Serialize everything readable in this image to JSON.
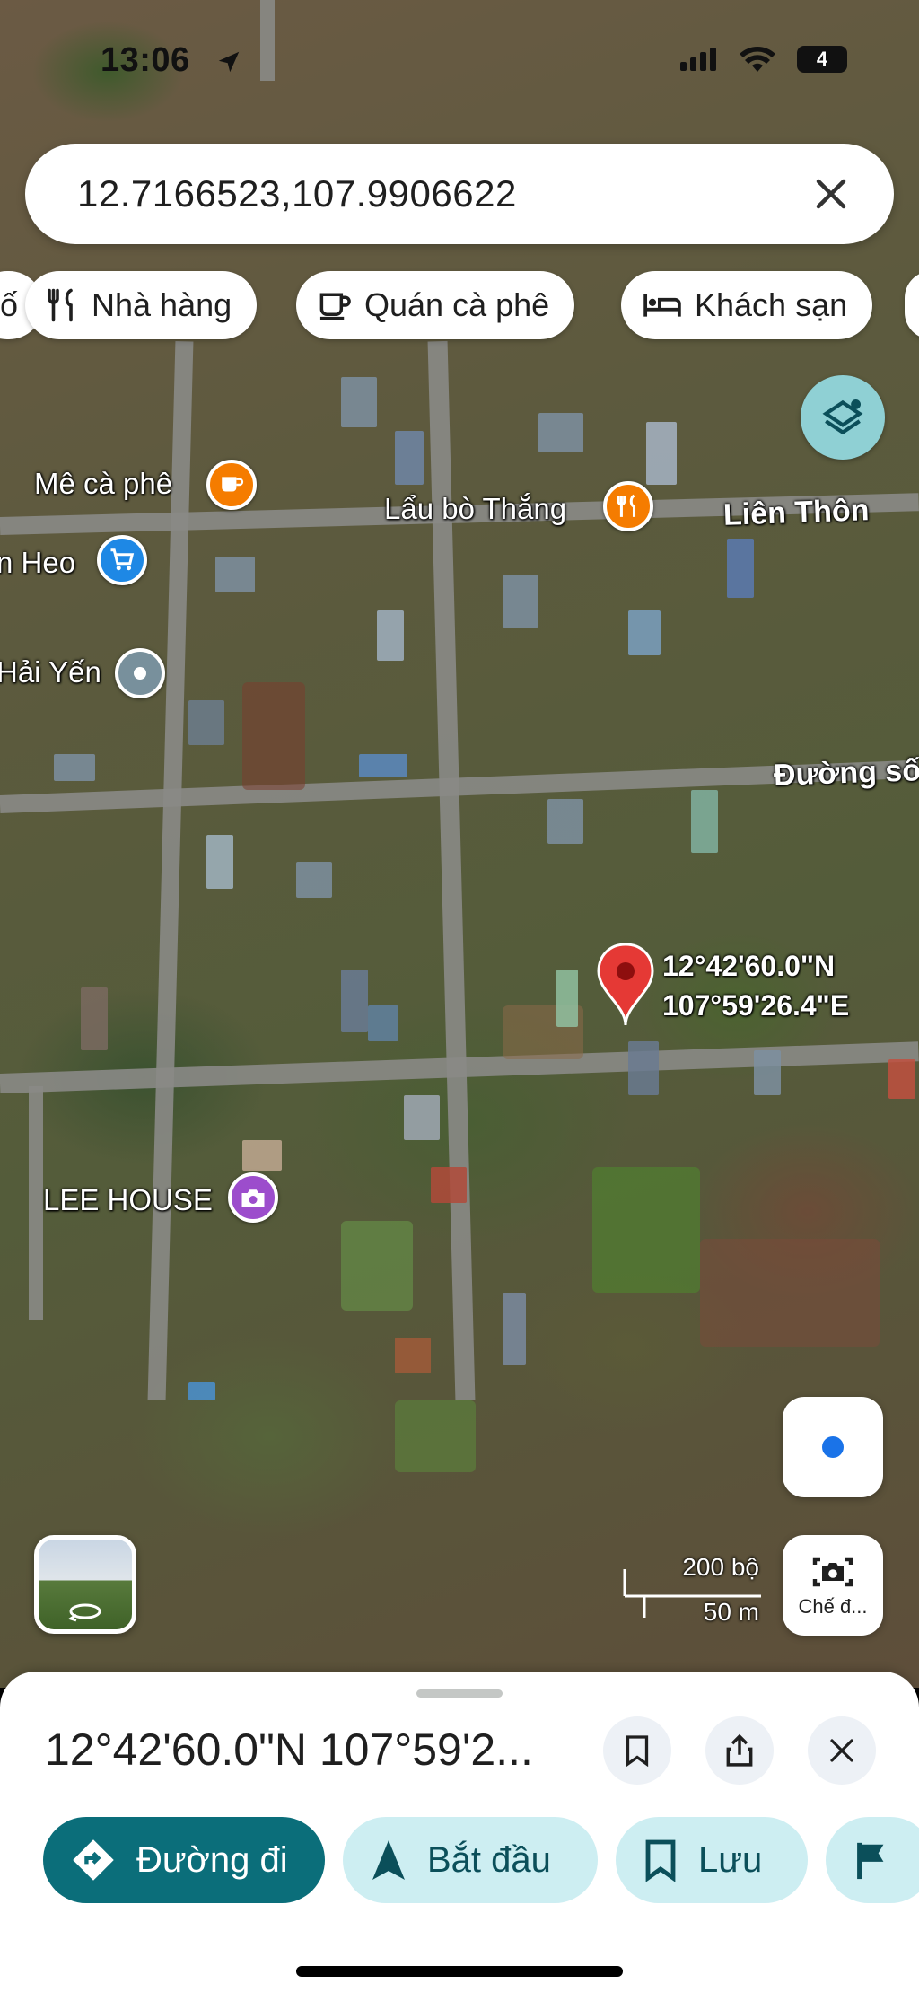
{
  "status_bar": {
    "time": "13:06",
    "battery_level": "4"
  },
  "search": {
    "query": "12.7166523,107.9906622"
  },
  "chips": [
    {
      "label": "ố",
      "icon": "more-icon"
    },
    {
      "label": "Nhà hàng",
      "icon": "restaurant-icon"
    },
    {
      "label": "Quán cà phê",
      "icon": "coffee-icon"
    },
    {
      "label": "Khách sạn",
      "icon": "hotel-icon"
    }
  ],
  "map": {
    "pois": [
      {
        "name": "Mê cà phê",
        "type": "cafe",
        "color": "#f57c00"
      },
      {
        "name": "Lẩu bò Thắng",
        "type": "restaurant",
        "color": "#f57c00"
      },
      {
        "name": "n Heo",
        "type": "shopping",
        "color": "#1e88e5"
      },
      {
        "name": "Hải Yến",
        "type": "generic",
        "color": "#78909c"
      },
      {
        "name": "LEE HOUSE",
        "type": "photo",
        "color": "#9c4dcc"
      }
    ],
    "roads": [
      "Liên Thôn",
      "Đường số"
    ],
    "dropped_pin": {
      "lat_label": "12°42'60.0\"N",
      "lng_label": "107°59'26.4\"E",
      "color": "#e53935"
    },
    "scale": {
      "imperial": "200 bộ",
      "metric": "50 m"
    },
    "lens_label": "Chế đ..."
  },
  "sheet": {
    "title": "12°42'60.0\"N 107°59'2...",
    "actions": [
      {
        "label": "Đường đi",
        "icon": "directions-icon"
      },
      {
        "label": "Bắt đầu",
        "icon": "navigation-icon"
      },
      {
        "label": "Lưu",
        "icon": "bookmark-icon"
      },
      {
        "label": "",
        "icon": "flag-icon"
      }
    ]
  },
  "colors": {
    "primary": "#0b6e7a",
    "secondary": "#cdeef2",
    "pin": "#e53935"
  }
}
